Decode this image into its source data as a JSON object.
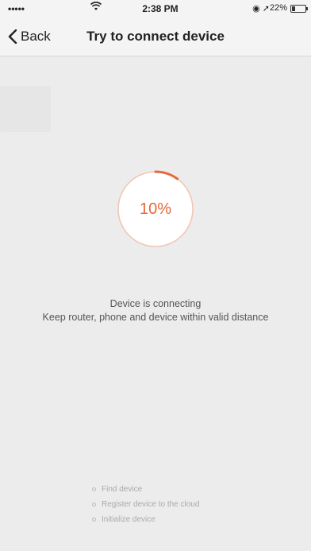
{
  "status_bar": {
    "signal": "•••••",
    "time": "2:38 PM",
    "battery_percent": "22%",
    "icons": [
      "wifi-icon",
      "location-icon",
      "battery-icon"
    ],
    "battery_level": 0.22
  },
  "nav": {
    "back_label": "Back",
    "title": "Try to connect device"
  },
  "progress": {
    "label": "10%",
    "value": 0.1,
    "accent_color": "#e7683b",
    "track_color": "#f1c4b2"
  },
  "message": {
    "line1": "Device is connecting",
    "line2": "Keep router, phone and device within valid distance"
  },
  "steps": [
    {
      "label": "Find device"
    },
    {
      "label": "Register device to the cloud"
    },
    {
      "label": "Initialize device"
    }
  ]
}
